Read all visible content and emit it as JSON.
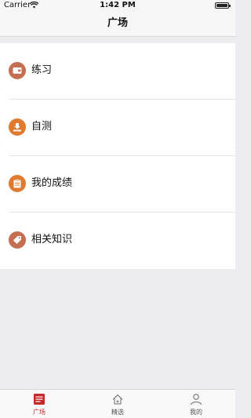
{
  "status_bar": {
    "carrier": "Carrier",
    "time": "1:42 PM"
  },
  "nav": {
    "title": "广场"
  },
  "list": {
    "items": [
      {
        "label": "练习",
        "icon": "wallet-icon",
        "color": "#c46e52"
      },
      {
        "label": "自测",
        "icon": "download-tray-icon",
        "color": "#e07a2e"
      },
      {
        "label": "我的成绩",
        "icon": "clipboard-icon",
        "color": "#e07a2e"
      },
      {
        "label": "相关知识",
        "icon": "tag-icon",
        "color": "#c46e52"
      }
    ]
  },
  "tabbar": {
    "items": [
      {
        "label": "广场",
        "icon": "list-card-icon",
        "active": true
      },
      {
        "label": "精选",
        "icon": "home-icon",
        "active": false
      },
      {
        "label": "我的",
        "icon": "person-icon",
        "active": false
      }
    ],
    "active_color": "#c62828"
  }
}
